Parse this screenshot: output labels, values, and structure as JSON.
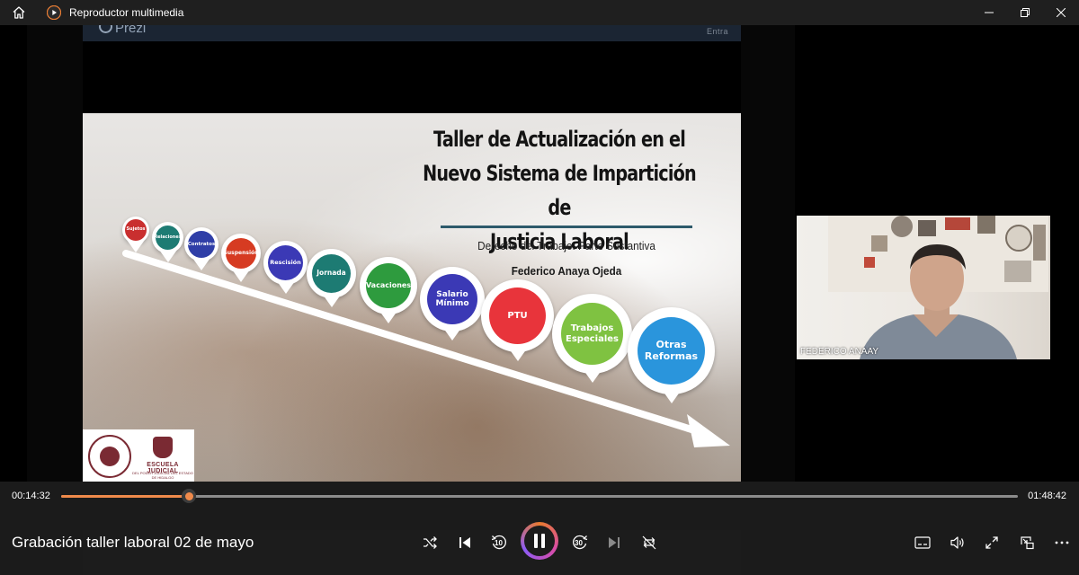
{
  "window": {
    "app_title": "Reproductor multimedia",
    "home_icon": "home-icon",
    "app_icon": "media-player-icon",
    "controls": [
      "minimize-icon",
      "restore-icon",
      "close-icon"
    ]
  },
  "prezi": {
    "logo_text": "Prezi",
    "entra_label": "Entra"
  },
  "slide": {
    "title_lines": [
      "Taller de Actualización en el",
      "Nuevo Sistema de Impartición de",
      "Justicia Laboral"
    ],
    "subtitle": "Derecho del Trabajo: Parte Sustantiva",
    "author": "Federico Anaya Ojeda",
    "topics": [
      {
        "label": "Sujetos",
        "color": "#c92f2f"
      },
      {
        "label": "Relaciones",
        "color": "#1d7b73"
      },
      {
        "label": "Contratos",
        "color": "#2f3ea7"
      },
      {
        "label": "Suspensión",
        "color": "#d63b22"
      },
      {
        "label": "Rescisión",
        "color": "#3b39b5"
      },
      {
        "label": "Jornada",
        "color": "#1d7b73"
      },
      {
        "label": "Vacaciones",
        "color": "#2e9b3e"
      },
      {
        "label": "Salario Mínimo",
        "color": "#3b39b5"
      },
      {
        "label": "PTU",
        "color": "#e8343b"
      },
      {
        "label": "Trabajos Especiales",
        "color": "#7fc241"
      },
      {
        "label": "Otras Reformas",
        "color": "#2a95dc"
      }
    ],
    "logo_school_name": "ESCUELA JUDICIAL",
    "logo_school_sub": "DEL PODER JUDICIAL DEL ESTADO DE HIDALGO"
  },
  "webcam": {
    "participant_name": "FEDERICO ANAAY"
  },
  "player": {
    "current_time": "00:14:32",
    "duration": "01:48:42",
    "progress_fraction": 0.1337,
    "media_title": "Grabación taller laboral 02 de mayo",
    "accent_color": "#f08a4b",
    "buttons": {
      "shuffle": "shuffle-icon",
      "previous": "previous-icon",
      "skip_back": "10",
      "play_pause": "pause-icon",
      "skip_forward": "30",
      "next": "next-icon",
      "repeat": "repeat-off-icon",
      "subtitles": "subtitles-icon",
      "volume": "volume-icon",
      "fullscreen": "fullscreen-icon",
      "mini_player": "mini-player-icon",
      "more": "more-icon"
    }
  }
}
